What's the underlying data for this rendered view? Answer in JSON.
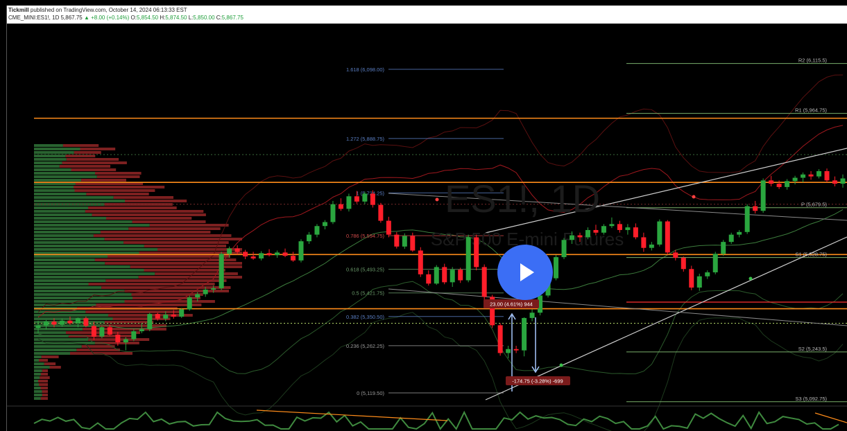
{
  "header": {
    "author": "Tickmill",
    "published_text": "published on TradingView.com, October 14, 2024 06:13:33 EST",
    "symbol": "CME_MINI:ES1!, 1D",
    "last": "5,867.75",
    "change": "▲ +8.00 (+0.14%)",
    "o_label": "O:",
    "o": "5,854.50",
    "h_label": "H:",
    "h": "5,874.50",
    "l_label": "L:",
    "l": "5,850.00",
    "c_label": "C:",
    "c": "5,867.75"
  },
  "watermark": {
    "ticker": "ES1!, 1D",
    "name": "S&P 500 E-mini Futures"
  },
  "colors": {
    "up": "#2aa63f",
    "down": "#ff1e2a",
    "fib": "#5b7fc4",
    "pivot_line": "#7ab06b",
    "orange": "#ff8c1a",
    "accent": "#3b6ef5"
  },
  "chart_data": {
    "type": "candlestick",
    "price_range": [
      5070,
      6140
    ],
    "fib_levels": [
      {
        "label": "1.618 (6,098.00)",
        "value": 6098.0
      },
      {
        "label": "1.272 (5,888.75)",
        "value": 5888.75
      },
      {
        "label": "1 (5,724.25)",
        "value": 5724.25
      },
      {
        "label": "0.786 (5,594.75)",
        "value": 5594.75
      },
      {
        "label": "0.618 (5,493.25)",
        "value": 5493.25
      },
      {
        "label": "0.5 (5,421.75)",
        "value": 5421.75
      },
      {
        "label": "0.382 (5,350.50)",
        "value": 5350.5
      },
      {
        "label": "0.236 (5,262.25)",
        "value": 5262.25
      },
      {
        "label": "0 (5,119.50)",
        "value": 5119.5
      }
    ],
    "pivots": [
      {
        "label": "R2 (6,115.5)",
        "value": 6115.5
      },
      {
        "label": "R1 (5,964.75)",
        "value": 5964.75
      },
      {
        "label": "P (5,679.5)",
        "value": 5679.5
      },
      {
        "label": "S1 (5,528.75)",
        "value": 5528.75
      },
      {
        "label": "S2 (5,243.5)",
        "value": 5243.5
      },
      {
        "label": "S3 (5,092.75)",
        "value": 5092.75
      }
    ],
    "measure_up": "23.00 (4.61%) 944",
    "measure_down": "-174.75 (-3.28%) -699",
    "horizontal_levels": [
      5950,
      5756,
      5538,
      5374
    ],
    "candles": [
      [
        5316,
        5338,
        5300,
        5323
      ],
      [
        5323,
        5340,
        5312,
        5335
      ],
      [
        5335,
        5345,
        5318,
        5326
      ],
      [
        5326,
        5344,
        5320,
        5338
      ],
      [
        5338,
        5350,
        5325,
        5330
      ],
      [
        5330,
        5348,
        5318,
        5345
      ],
      [
        5345,
        5350,
        5318,
        5322
      ],
      [
        5322,
        5335,
        5280,
        5290
      ],
      [
        5290,
        5322,
        5285,
        5318
      ],
      [
        5318,
        5326,
        5292,
        5296
      ],
      [
        5296,
        5304,
        5262,
        5272
      ],
      [
        5272,
        5288,
        5248,
        5282
      ],
      [
        5282,
        5312,
        5276,
        5306
      ],
      [
        5306,
        5330,
        5300,
        5312
      ],
      [
        5312,
        5362,
        5306,
        5358
      ],
      [
        5358,
        5362,
        5338,
        5344
      ],
      [
        5344,
        5366,
        5336,
        5356
      ],
      [
        5356,
        5370,
        5344,
        5350
      ],
      [
        5350,
        5376,
        5346,
        5372
      ],
      [
        5372,
        5414,
        5368,
        5408
      ],
      [
        5408,
        5424,
        5396,
        5418
      ],
      [
        5418,
        5440,
        5410,
        5432
      ],
      [
        5432,
        5444,
        5422,
        5436
      ],
      [
        5436,
        5546,
        5430,
        5540
      ],
      [
        5540,
        5562,
        5528,
        5556
      ],
      [
        5556,
        5566,
        5538,
        5546
      ],
      [
        5546,
        5552,
        5524,
        5532
      ],
      [
        5532,
        5546,
        5522,
        5526
      ],
      [
        5526,
        5548,
        5520,
        5542
      ],
      [
        5542,
        5554,
        5532,
        5536
      ],
      [
        5536,
        5550,
        5528,
        5544
      ],
      [
        5544,
        5556,
        5530,
        5534
      ],
      [
        5534,
        5546,
        5516,
        5520
      ],
      [
        5520,
        5584,
        5514,
        5578
      ],
      [
        5578,
        5606,
        5570,
        5598
      ],
      [
        5598,
        5630,
        5590,
        5624
      ],
      [
        5624,
        5642,
        5614,
        5636
      ],
      [
        5636,
        5700,
        5630,
        5690
      ],
      [
        5690,
        5708,
        5670,
        5676
      ],
      [
        5676,
        5722,
        5668,
        5714
      ],
      [
        5714,
        5730,
        5692,
        5698
      ],
      [
        5698,
        5728,
        5690,
        5722
      ],
      [
        5722,
        5732,
        5680,
        5688
      ],
      [
        5688,
        5694,
        5634,
        5640
      ],
      [
        5640,
        5652,
        5590,
        5598
      ],
      [
        5598,
        5606,
        5556,
        5562
      ],
      [
        5562,
        5602,
        5555,
        5594
      ],
      [
        5594,
        5604,
        5546,
        5550
      ],
      [
        5550,
        5560,
        5470,
        5478
      ],
      [
        5478,
        5490,
        5444,
        5450
      ],
      [
        5450,
        5506,
        5446,
        5500
      ],
      [
        5500,
        5510,
        5448,
        5454
      ],
      [
        5454,
        5500,
        5440,
        5492
      ],
      [
        5492,
        5498,
        5452,
        5460
      ],
      [
        5460,
        5598,
        5454,
        5590
      ],
      [
        5590,
        5598,
        5490,
        5500
      ],
      [
        5500,
        5508,
        5394,
        5410
      ],
      [
        5410,
        5416,
        5316,
        5324
      ],
      [
        5324,
        5330,
        5232,
        5240
      ],
      [
        5240,
        5262,
        5224,
        5252
      ],
      [
        5252,
        5262,
        5240,
        5248
      ],
      [
        5248,
        5348,
        5230,
        5346
      ],
      [
        5346,
        5372,
        5336,
        5362
      ],
      [
        5362,
        5420,
        5354,
        5414
      ],
      [
        5414,
        5472,
        5408,
        5466
      ],
      [
        5466,
        5536,
        5460,
        5530
      ],
      [
        5530,
        5588,
        5524,
        5582
      ],
      [
        5582,
        5608,
        5570,
        5596
      ],
      [
        5596,
        5604,
        5576,
        5590
      ],
      [
        5590,
        5620,
        5584,
        5612
      ],
      [
        5612,
        5628,
        5596,
        5604
      ],
      [
        5604,
        5630,
        5598,
        5624
      ],
      [
        5624,
        5650,
        5618,
        5630
      ],
      [
        5630,
        5640,
        5604,
        5612
      ],
      [
        5612,
        5630,
        5598,
        5620
      ],
      [
        5620,
        5632,
        5584,
        5590
      ],
      [
        5590,
        5604,
        5546,
        5558
      ],
      [
        5558,
        5576,
        5550,
        5568
      ],
      [
        5568,
        5644,
        5562,
        5638
      ],
      [
        5638,
        5642,
        5538,
        5544
      ],
      [
        5544,
        5552,
        5520,
        5528
      ],
      [
        5528,
        5532,
        5486,
        5494
      ],
      [
        5494,
        5504,
        5430,
        5438
      ],
      [
        5438,
        5480,
        5428,
        5472
      ],
      [
        5472,
        5490,
        5464,
        5484
      ],
      [
        5484,
        5546,
        5478,
        5540
      ],
      [
        5540,
        5582,
        5534,
        5576
      ],
      [
        5576,
        5604,
        5570,
        5598
      ],
      [
        5598,
        5612,
        5590,
        5606
      ],
      [
        5606,
        5690,
        5600,
        5684
      ],
      [
        5684,
        5700,
        5662,
        5670
      ],
      [
        5670,
        5768,
        5664,
        5762
      ],
      [
        5762,
        5776,
        5744,
        5752
      ],
      [
        5752,
        5762,
        5736,
        5742
      ],
      [
        5742,
        5766,
        5734,
        5760
      ],
      [
        5760,
        5776,
        5750,
        5770
      ],
      [
        5770,
        5786,
        5756,
        5780
      ],
      [
        5780,
        5790,
        5764,
        5774
      ],
      [
        5774,
        5796,
        5768,
        5790
      ],
      [
        5790,
        5798,
        5756,
        5762
      ],
      [
        5762,
        5774,
        5744,
        5752
      ],
      [
        5752,
        5780,
        5740,
        5768
      ]
    ]
  }
}
